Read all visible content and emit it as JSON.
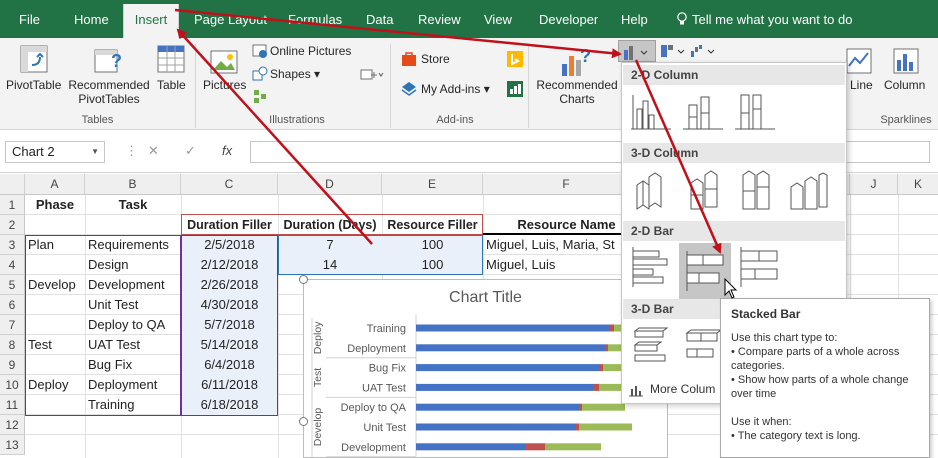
{
  "tabs": [
    "File",
    "Home",
    "Insert",
    "Page Layout",
    "Formulas",
    "Data",
    "Review",
    "View",
    "Developer",
    "Help"
  ],
  "tell_me": "Tell me what you want to do",
  "ribbon": {
    "pivottable": "PivotTable",
    "recommended_pivottables": [
      "Recommended",
      "PivotTables"
    ],
    "table": "Table",
    "pictures": "Pictures",
    "online_pictures": "Online Pictures",
    "shapes": "Shapes",
    "store": "Store",
    "my_addins": "My Add-ins",
    "recommended_charts": [
      "Recommended",
      "Charts"
    ],
    "line": "Line",
    "column": "Column",
    "groups": {
      "tables": "Tables",
      "illustrations": "Illustrations",
      "addins": "Add-ins",
      "sparklines": "Sparklines"
    }
  },
  "namebox": "Chart 2",
  "fx": "fx",
  "columns": [
    "A",
    "B",
    "C",
    "D",
    "E",
    "F",
    "G",
    "H",
    "I",
    "J",
    "K"
  ],
  "rows": [
    "1",
    "2",
    "3",
    "4",
    "5",
    "6",
    "7",
    "8",
    "9",
    "10",
    "11",
    "12",
    "13"
  ],
  "cells": {
    "phase_header": "Phase",
    "task_header": "Task",
    "duration_filler": "Duration Filler",
    "duration_days": "Duration (Days)",
    "resource_filler": "Resource Filler",
    "resource_name": "Resource Name",
    "phases": [
      "Plan",
      "",
      "Develop",
      "",
      "",
      "Test",
      "",
      "Deploy",
      ""
    ],
    "tasks": [
      "Requirements",
      "Design",
      "Development",
      "Unit Test",
      "Deploy to QA",
      "UAT Test",
      "Bug Fix",
      "Deployment",
      "Training"
    ],
    "dates": [
      "2/5/2018",
      "2/12/2018",
      "2/26/2018",
      "4/30/2018",
      "5/7/2018",
      "5/14/2018",
      "6/4/2018",
      "6/11/2018",
      "6/18/2018"
    ],
    "durations": [
      "7",
      "14"
    ],
    "resources": [
      "100",
      "100"
    ],
    "names": [
      "Miguel, Luis, Maria, St",
      "Miguel, Luis"
    ]
  },
  "chart_data": {
    "type": "bar",
    "title": "Chart Title",
    "groups": [
      "Deploy",
      "Test",
      "Develop"
    ],
    "categories": [
      "Training",
      "Deployment",
      "Bug Fix",
      "UAT Test",
      "Deploy to QA",
      "Unit Test",
      "Development"
    ],
    "series": [
      {
        "color": "#4472c4",
        "values": [
          193,
          189,
          184,
          177,
          163,
          160,
          110
        ]
      },
      {
        "color": "#c0504d",
        "values": [
          5,
          3,
          3,
          6,
          3,
          3,
          19
        ]
      },
      {
        "color": "#9bbb59",
        "values": [
          35,
          45,
          40,
          48,
          43,
          53,
          56
        ]
      }
    ]
  },
  "dropdown": {
    "section_2d_column": "2-D Column",
    "section_3d_column": "3-D Column",
    "section_2d_bar": "2-D Bar",
    "section_3d_bar": "3-D Bar",
    "more": "More Colum"
  },
  "tooltip": {
    "title": "Stacked Bar",
    "intro": "Use this chart type to:",
    "bullet1": "• Compare parts of a whole across categories.",
    "bullet2": "• Show how parts of a whole change over time",
    "use_when": "Use it when:",
    "bullet3": "• The category text is long."
  },
  "colors": {
    "excel_green": "#217346",
    "arrow_red": "#c0101a",
    "selection_purple": "#7030a0",
    "highlight_red": "#c0504d",
    "series_blue": "#4472c4"
  }
}
